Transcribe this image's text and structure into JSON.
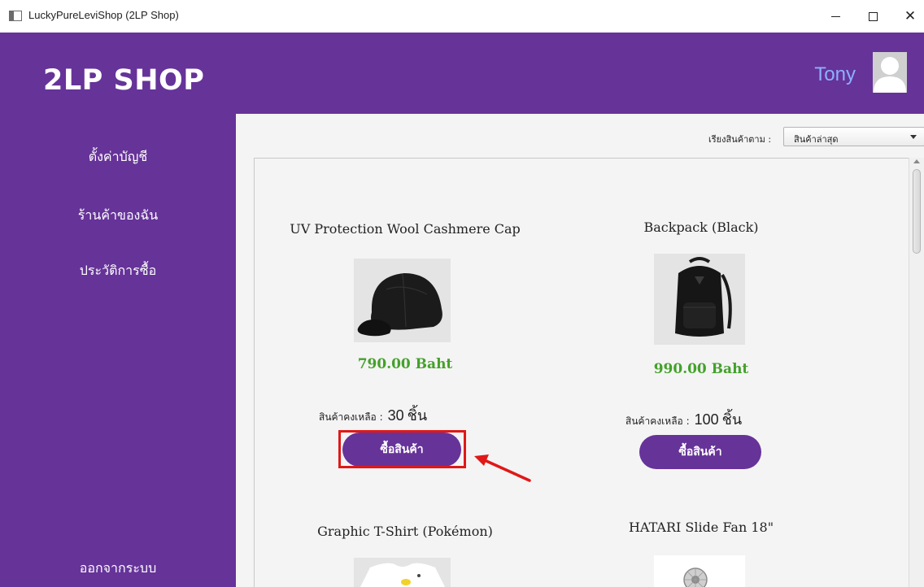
{
  "window": {
    "title": "LuckyPureLeviShop (2LP Shop)"
  },
  "header": {
    "logo": "2LP SHOP",
    "username": "Tony"
  },
  "sidebar": {
    "items": [
      {
        "label": "ตั้งค่าบัญชี"
      },
      {
        "label": "ร้านค้าของฉัน"
      },
      {
        "label": "ประวัติการซื้อ"
      }
    ],
    "logout": "ออกจากระบบ"
  },
  "sort": {
    "label": "เรียงสินค้าตาม :",
    "selected": "สินค้าล่าสุด"
  },
  "products": [
    {
      "name": "UV Protection Wool Cashmere Cap",
      "price": "790.00 Baht",
      "stock_label": "สินค้าคงเหลือ :",
      "stock": "30",
      "unit": "ชิ้น",
      "buy_label": "ซื้อสินค้า"
    },
    {
      "name": "Backpack (Black)",
      "price": "990.00 Baht",
      "stock_label": "สินค้าคงเหลือ :",
      "stock": "100",
      "unit": "ชิ้น",
      "buy_label": "ซื้อสินค้า"
    },
    {
      "name": "Graphic T-Shirt (Pokémon)"
    },
    {
      "name": "HATARI Slide Fan 18\""
    }
  ],
  "colors": {
    "brand": "#663399",
    "price": "#44a12b",
    "username": "#8db0ff",
    "annotation": "#e01818"
  }
}
